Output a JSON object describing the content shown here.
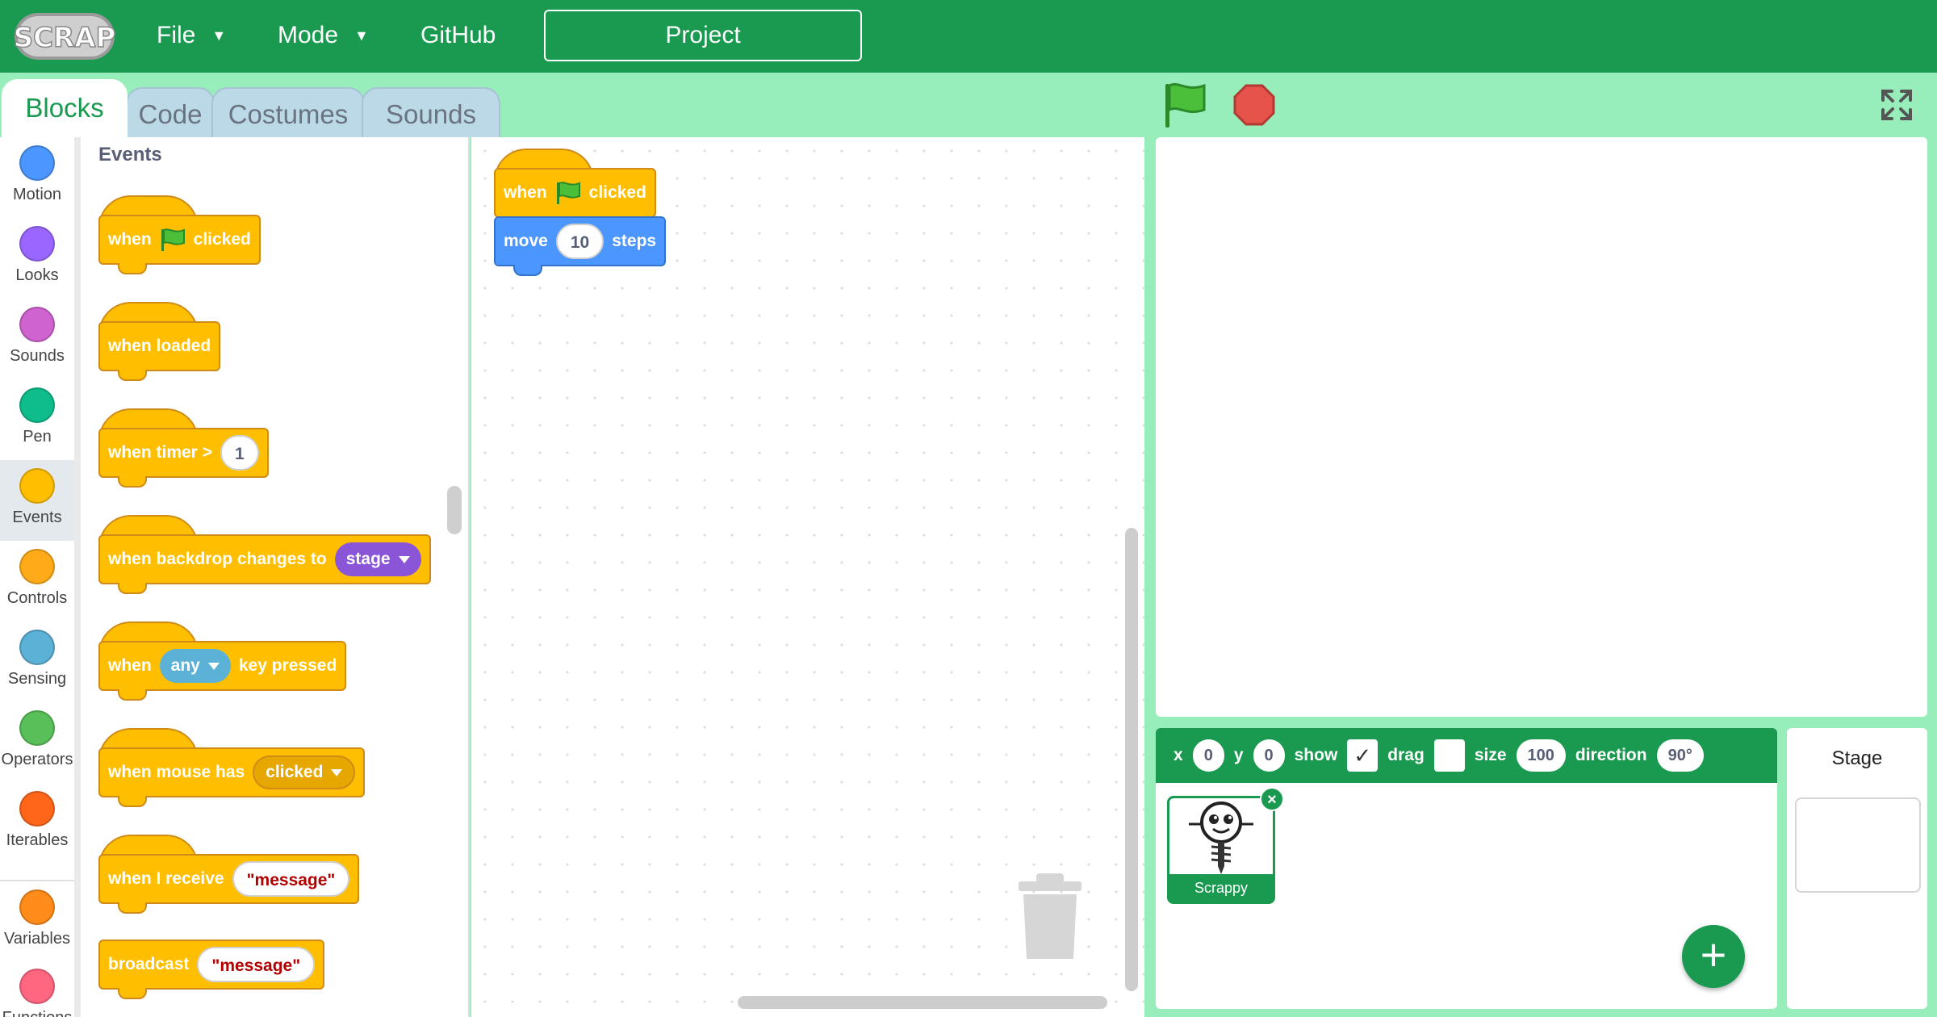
{
  "app": {
    "logo_text": "SCRAP"
  },
  "menu": {
    "file_label": "File",
    "mode_label": "Mode",
    "github_label": "GitHub",
    "project_label": "Project"
  },
  "tabs": {
    "blocks": "Blocks",
    "code": "Code",
    "costumes": "Costumes",
    "sounds": "Sounds"
  },
  "categories": [
    {
      "label": "Motion",
      "color": "#4c97ff"
    },
    {
      "label": "Looks",
      "color": "#9966ff"
    },
    {
      "label": "Sounds",
      "color": "#cf63cf"
    },
    {
      "label": "Pen",
      "color": "#0fbd8c"
    },
    {
      "label": "Events",
      "color": "#ffbf00"
    },
    {
      "label": "Controls",
      "color": "#ffab19"
    },
    {
      "label": "Sensing",
      "color": "#5cb1d6"
    },
    {
      "label": "Operators",
      "color": "#59c059"
    },
    {
      "label": "Iterables",
      "color": "#ff661a"
    },
    {
      "label": "Variables",
      "color": "#ff8c1a"
    },
    {
      "label": "Functions",
      "color": "#ff6680"
    }
  ],
  "palette": {
    "title": "Events",
    "b1": {
      "when": "when",
      "clicked": "clicked"
    },
    "b2": {
      "text": "when loaded"
    },
    "b3": {
      "text": "when timer >",
      "value": "1"
    },
    "b4": {
      "text": "when backdrop changes to",
      "dropdown": "stage"
    },
    "b5": {
      "when": "when",
      "dropdown": "any",
      "rest": "key pressed"
    },
    "b6": {
      "text": "when mouse has",
      "dropdown": "clicked"
    },
    "b7": {
      "text": "when I receive",
      "value": "\"message\""
    },
    "b8": {
      "text": "broadcast",
      "value": "\"message\""
    }
  },
  "script": {
    "hat": {
      "when": "when",
      "clicked": "clicked"
    },
    "move": {
      "label": "move",
      "value": "10",
      "unit": "steps"
    }
  },
  "sprite_props": {
    "x_label": "x",
    "x_value": "0",
    "y_label": "y",
    "y_value": "0",
    "show_label": "show",
    "show_check": "✓",
    "drag_label": "drag",
    "size_label": "size",
    "size_value": "100",
    "direction_label": "direction",
    "direction_value": "90°"
  },
  "sprites": [
    {
      "name": "Scrappy"
    }
  ],
  "stage_panel": {
    "title": "Stage"
  },
  "colors": {
    "brand": "#1a9a50",
    "background": "#97eebb",
    "events": "#ffbf00",
    "motion": "#4c97ff"
  }
}
